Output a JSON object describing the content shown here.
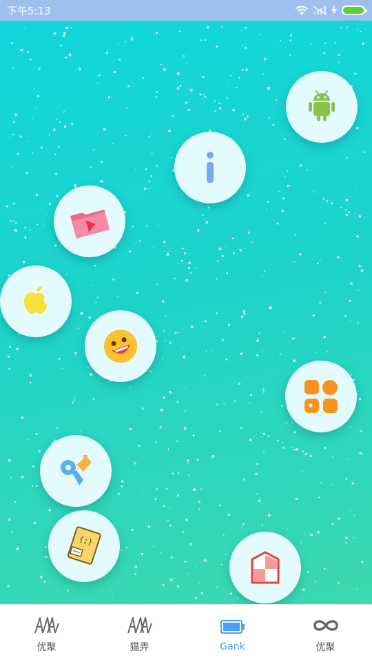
{
  "status_bar": {
    "time": "下午5:13",
    "background": "#9ec0ee"
  },
  "background": {
    "gradient_start": "#12d6dc",
    "gradient_end": "#3dd9b0"
  },
  "bubbles": [
    {
      "icon": "android-icon"
    },
    {
      "icon": "info-icon"
    },
    {
      "icon": "video-folder-icon"
    },
    {
      "icon": "apple-icon"
    },
    {
      "icon": "emoji-face-icon"
    },
    {
      "icon": "apps-grid-icon"
    },
    {
      "icon": "app-logo-icon"
    },
    {
      "icon": "code-book-icon"
    },
    {
      "icon": "shield-icon"
    }
  ],
  "bottom_nav": {
    "items": [
      {
        "label": "优聚",
        "icon": "aa-icon",
        "active": false
      },
      {
        "label": "猫弄",
        "icon": "aa-icon",
        "active": false
      },
      {
        "label": "Gank",
        "icon": "battery-icon",
        "active": true
      },
      {
        "label": "优聚",
        "icon": "infinity-icon",
        "active": false
      }
    ],
    "active_color": "#4a9ef5"
  }
}
